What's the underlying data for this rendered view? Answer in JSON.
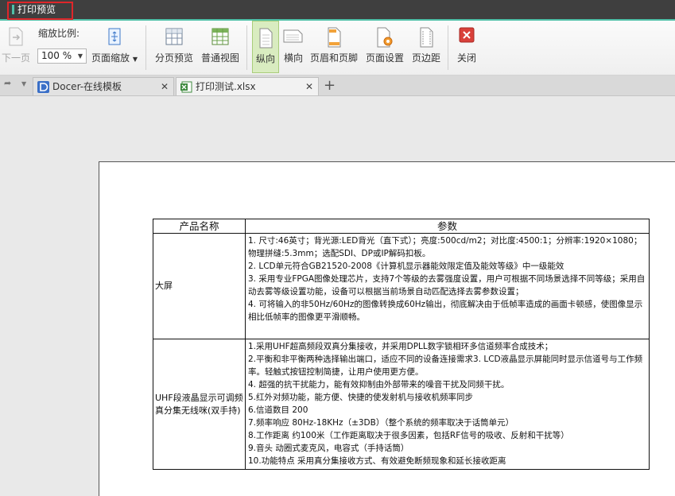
{
  "titlebar": {
    "title": "打印预览"
  },
  "toolbar": {
    "prev_page": "下一页",
    "zoom_label": "缩放比例:",
    "zoom_value": "100 %",
    "page_zoom": "页面缩放",
    "page_break_preview": "分页预览",
    "normal_view": "普通视图",
    "portrait": "纵向",
    "landscape": "横向",
    "header_footer": "页眉和页脚",
    "page_setup": "页面设置",
    "margins": "页边距",
    "close": "关闭"
  },
  "tabs": [
    {
      "label": "Docer-在线模板",
      "close": "✕"
    },
    {
      "label": "打印测试.xlsx",
      "close": "✕"
    }
  ],
  "table": {
    "headers": [
      "产品名称",
      "参数"
    ],
    "rows": [
      {
        "name": "大屏",
        "params": [
          "1. 尺寸:46英寸；背光源:LED背光（直下式）；亮度:500cd/m2；对比度:4500:1；分辨率:1920×1080；物理拼缝:5.3mm；选配SDI、DP或IP解码扣板。",
          "2. LCD单元符合GB21520-2008《计算机显示器能效限定值及能效等级》中一级能效",
          "3. 采用专业FPGA图像处理芯片，支持7个等级的去雾强度设置，用户可根据不同场景选择不同等级；采用自动去雾等级设置功能，设备可以根据当前场景自动匹配选择去雾参数设置；",
          "4. 可将输入的非50Hz/60Hz的图像转换成60Hz输出，彻底解决由于低帧率造成的画面卡顿感，使图像显示相比低帧率的图像更平滑顺畅。"
        ]
      },
      {
        "name": "UHF段液晶显示可调频真分集无线咪(双手持)",
        "params": [
          "1.采用UHF超高频段双真分集接收，并采用DPLL数字锁相环多信道频率合成技术；",
          "2.平衡和非平衡两种选择输出端口，适应不同的设备连接需求3. LCD液晶显示屏能同时显示信道号与工作频率。轻触式按钮控制简捷，让用户使用更方便。",
          "4. 超强的抗干扰能力，能有效抑制由外部带来的噪音干扰及同频干扰。",
          "5.红外对频功能，能方便、快捷的使发射机与接收机频率同步",
          "6.信道数目 200",
          "7.频率响应 80Hz-18KHz（±3DB）（整个系统的频率取决于话筒单元）",
          "8.工作距离 约100米（工作距离取决于很多因素，包括RF信号的吸收、反射和干扰等）",
          "9.音头 动圈式麦克风，电容式（手持话筒）",
          "10.功能特点 采用真分集接收方式、有效避免断频现象和延长接收距离"
        ]
      }
    ]
  },
  "colors": {
    "accent": "#4fc0a8",
    "highlight_box": "#e0262a",
    "active_btn": "#d9ecc0",
    "close_red": "#d9403a"
  },
  "icons": [
    "next-page-icon",
    "page-zoom-icon",
    "page-break-preview-icon",
    "normal-view-icon",
    "portrait-icon",
    "landscape-icon",
    "header-footer-icon",
    "page-setup-icon",
    "margins-icon",
    "close-icon",
    "docer-icon",
    "excel-icon",
    "plus-icon"
  ]
}
